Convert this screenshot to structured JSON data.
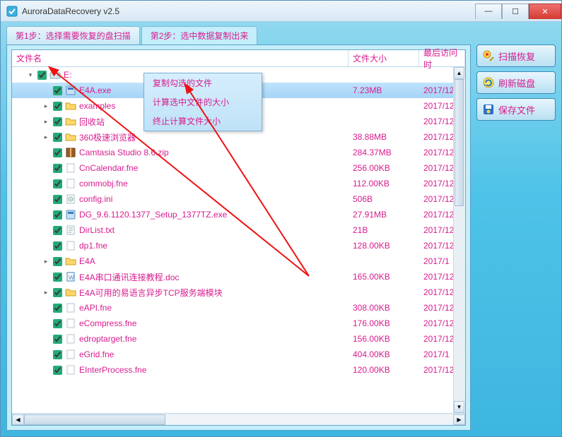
{
  "app_title": "AuroraDataRecovery v2.5",
  "tabs": [
    {
      "label": "第1步：选择需要恢复的盘扫描"
    },
    {
      "label": "第2步：选中数据复制出来"
    }
  ],
  "columns": {
    "name": "文件名",
    "size": "文件大小",
    "date": "最后访问时"
  },
  "context_menu": [
    "复制勾选的文件",
    "计算选中文件的大小",
    "终止计算文件大小"
  ],
  "buttons": {
    "scan": "扫描恢复",
    "refresh": "刷新磁盘",
    "save": "保存文件"
  },
  "rows": [
    {
      "depth": 0,
      "exp": "▾",
      "icon": "drive",
      "name": "E:",
      "size": "",
      "date": "",
      "sel": false
    },
    {
      "depth": 1,
      "exp": "",
      "icon": "exe",
      "name": "E4A.exe",
      "size": "7.23MB",
      "date": "2017/12",
      "sel": true
    },
    {
      "depth": 1,
      "exp": "▸",
      "icon": "folder",
      "name": "examples",
      "size": "",
      "date": "2017/12",
      "sel": false
    },
    {
      "depth": 1,
      "exp": "▸",
      "icon": "folder",
      "name": "回收站",
      "size": "",
      "date": "2017/12",
      "sel": false
    },
    {
      "depth": 1,
      "exp": "▸",
      "icon": "folder",
      "name": "360极速浏览器",
      "size": "38.88MB",
      "date": "2017/12",
      "sel": false
    },
    {
      "depth": 1,
      "exp": "",
      "icon": "zip",
      "name": "Camtasia Studio 8.6.zip",
      "size": "284.37MB",
      "date": "2017/12",
      "sel": false
    },
    {
      "depth": 1,
      "exp": "",
      "icon": "file",
      "name": "CnCalendar.fne",
      "size": "256.00KB",
      "date": "2017/12",
      "sel": false
    },
    {
      "depth": 1,
      "exp": "",
      "icon": "file",
      "name": "commobj.fne",
      "size": "112.00KB",
      "date": "2017/12",
      "sel": false
    },
    {
      "depth": 1,
      "exp": "",
      "icon": "ini",
      "name": "config.ini",
      "size": "506B",
      "date": "2017/12",
      "sel": false
    },
    {
      "depth": 1,
      "exp": "",
      "icon": "exe",
      "name": "DG_9.6.1120.1377_Setup_1377TZ.exe",
      "size": "27.91MB",
      "date": "2017/12",
      "sel": false
    },
    {
      "depth": 1,
      "exp": "",
      "icon": "txt",
      "name": "DirList.txt",
      "size": "21B",
      "date": "2017/12",
      "sel": false
    },
    {
      "depth": 1,
      "exp": "",
      "icon": "file",
      "name": "dp1.fne",
      "size": "128.00KB",
      "date": "2017/12",
      "sel": false
    },
    {
      "depth": 1,
      "exp": "▸",
      "icon": "folder",
      "name": "E4A",
      "size": "",
      "date": "2017/1",
      "sel": false
    },
    {
      "depth": 1,
      "exp": "",
      "icon": "doc",
      "name": "E4A串口通讯连接教程.doc",
      "size": "165.00KB",
      "date": "2017/12",
      "sel": false
    },
    {
      "depth": 1,
      "exp": "▸",
      "icon": "folder",
      "name": "E4A可用的易语言异步TCP服务端模块",
      "size": "",
      "date": "2017/12",
      "sel": false
    },
    {
      "depth": 1,
      "exp": "",
      "icon": "file",
      "name": "eAPI.fne",
      "size": "308.00KB",
      "date": "2017/12",
      "sel": false
    },
    {
      "depth": 1,
      "exp": "",
      "icon": "file",
      "name": "eCompress.fne",
      "size": "176.00KB",
      "date": "2017/12",
      "sel": false
    },
    {
      "depth": 1,
      "exp": "",
      "icon": "file",
      "name": "edroptarget.fne",
      "size": "156.00KB",
      "date": "2017/12",
      "sel": false
    },
    {
      "depth": 1,
      "exp": "",
      "icon": "file",
      "name": "eGrid.fne",
      "size": "404.00KB",
      "date": "2017/1",
      "sel": false
    },
    {
      "depth": 1,
      "exp": "",
      "icon": "file",
      "name": "EInterProcess.fne",
      "size": "120.00KB",
      "date": "2017/12",
      "sel": false
    }
  ]
}
